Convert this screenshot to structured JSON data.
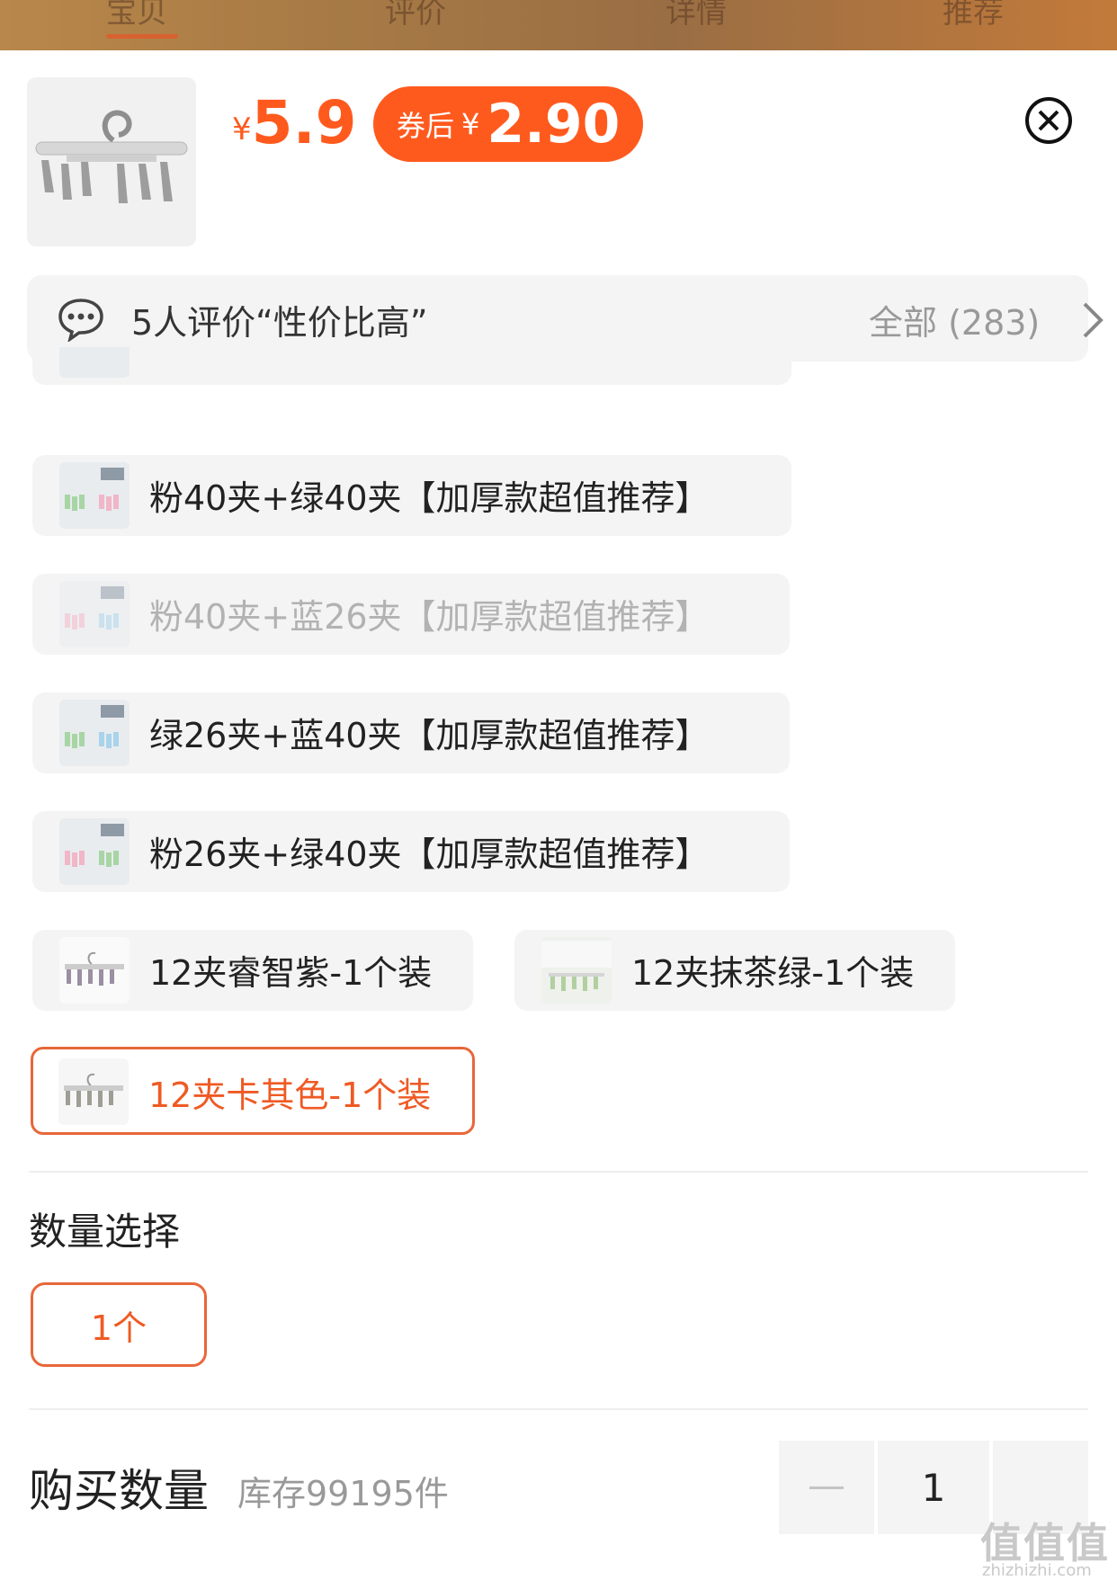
{
  "tabs": [
    {
      "label": "宝贝"
    },
    {
      "label": "评价"
    },
    {
      "label": "详情"
    },
    {
      "label": "推荐"
    }
  ],
  "price": {
    "currency": "¥",
    "value": "5.9"
  },
  "coupon": {
    "label": "券后",
    "currency": "¥",
    "value": "2.90"
  },
  "review": {
    "summary": "5人评价“性价比高”",
    "all": "全部 (283)"
  },
  "options": [
    {
      "label": "粉40夹+绿40夹【加厚款超值推荐】",
      "state": "normal"
    },
    {
      "label": "粉40夹+蓝26夹【加厚款超值推荐】",
      "state": "disabled"
    },
    {
      "label": "绿26夹+蓝40夹【加厚款超值推荐】",
      "state": "normal"
    },
    {
      "label": "粉26夹+绿40夹【加厚款超值推荐】",
      "state": "normal"
    },
    {
      "label": "12夹睿智紫-1个装",
      "state": "normal"
    },
    {
      "label": "12夹抹茶绿-1个装",
      "state": "normal"
    },
    {
      "label": "12夹卡其色-1个装",
      "state": "selected"
    }
  ],
  "quantity_select": {
    "title": "数量选择",
    "options": [
      "1个"
    ]
  },
  "purchase": {
    "title": "购买数量",
    "stock": "库存99195件",
    "quantity": "1"
  },
  "watermark": {
    "text": "值值值",
    "site": "zhizhizhi.com"
  },
  "colors": {
    "accent": "#ff5a1e",
    "selected_border": "#e8673a",
    "option_bg": "#f4f4f4"
  }
}
